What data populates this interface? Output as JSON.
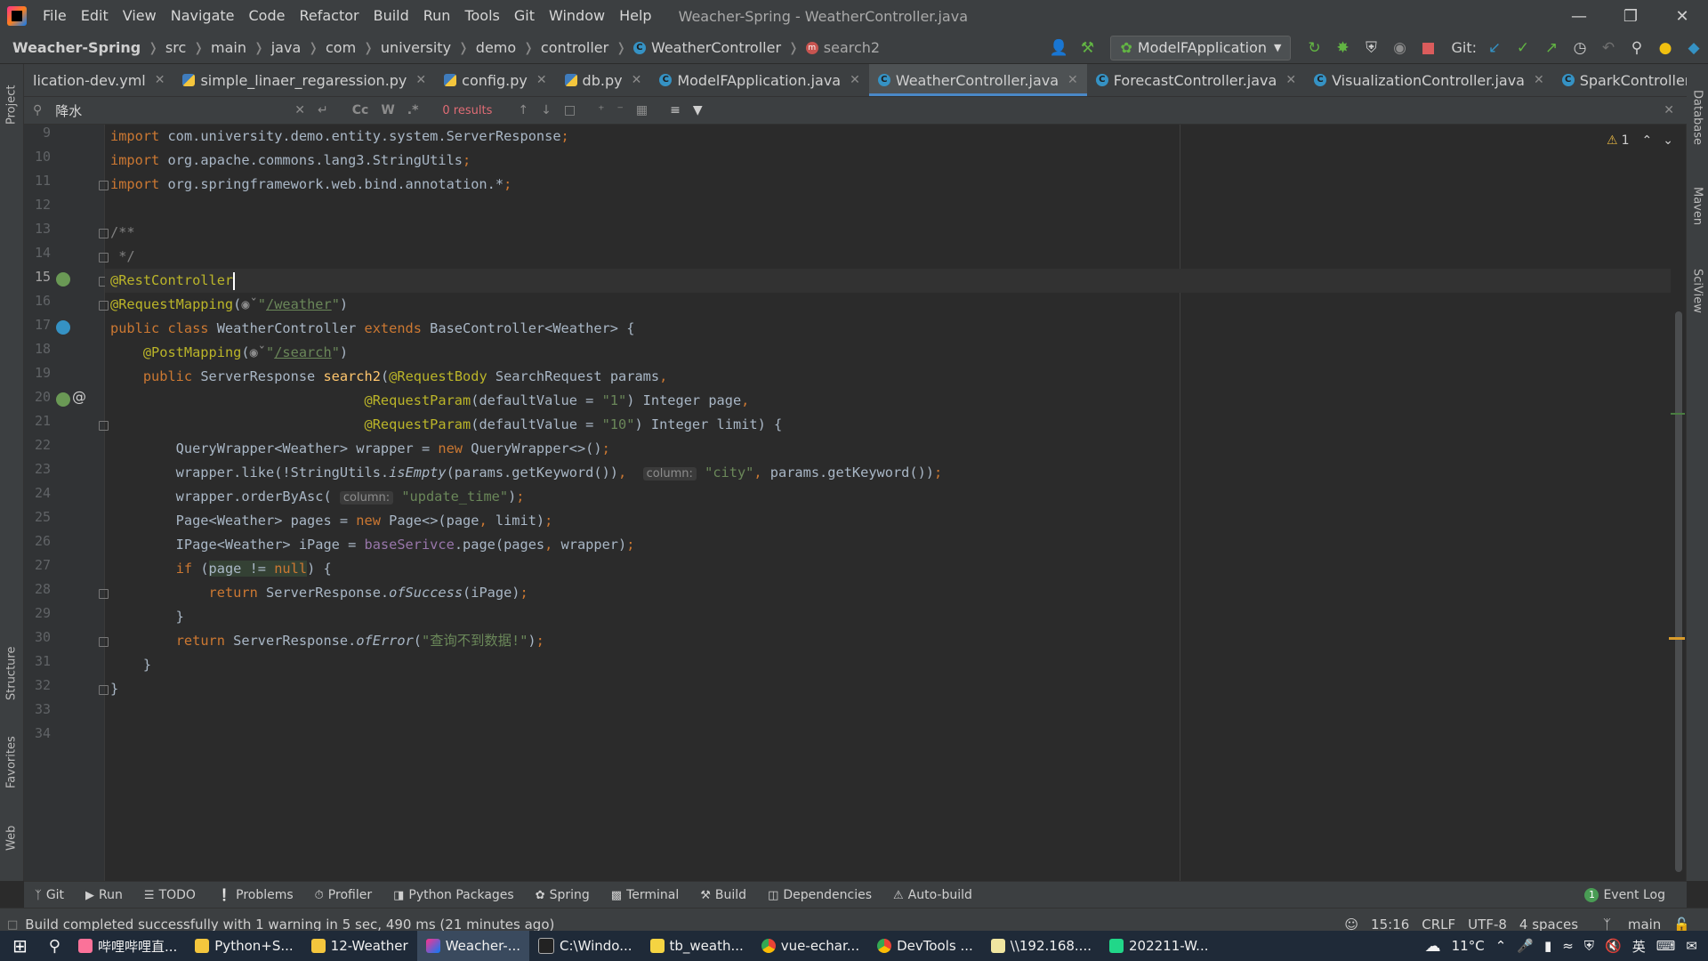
{
  "app": {
    "menu": [
      "File",
      "Edit",
      "View",
      "Navigate",
      "Code",
      "Refactor",
      "Build",
      "Run",
      "Tools",
      "Git",
      "Window",
      "Help"
    ],
    "window_title": "Weacher-Spring - WeatherController.java"
  },
  "breadcrumb": [
    "Weacher-Spring",
    "src",
    "main",
    "java",
    "com",
    "university",
    "demo",
    "controller",
    "WeatherController",
    "search2"
  ],
  "toolbar": {
    "run_config": "ModelFApplication",
    "git_label": "Git:"
  },
  "tabs": [
    {
      "label": "lication-dev.yml",
      "type": "yml",
      "active": false
    },
    {
      "label": "simple_linaer_regaression.py",
      "type": "py",
      "active": false
    },
    {
      "label": "config.py",
      "type": "py",
      "active": false
    },
    {
      "label": "db.py",
      "type": "py",
      "active": false
    },
    {
      "label": "ModelFApplication.java",
      "type": "java",
      "active": false
    },
    {
      "label": "WeatherController.java",
      "type": "java",
      "active": true
    },
    {
      "label": "ForecastController.java",
      "type": "java",
      "active": false
    },
    {
      "label": "VisualizationController.java",
      "type": "java",
      "active": false
    },
    {
      "label": "SparkController.java",
      "type": "java",
      "active": false
    }
  ],
  "search": {
    "value": "降水",
    "results": "0 results",
    "options": [
      "Cc",
      "W",
      ".*"
    ]
  },
  "editor": {
    "line_numbers": [
      "9",
      "10",
      "11",
      "12",
      "13",
      "14",
      "15",
      "16",
      "17",
      "18",
      "19",
      "20",
      "21",
      "22",
      "23",
      "24",
      "25",
      "26",
      "27",
      "28",
      "29",
      "30",
      "31",
      "32",
      "33",
      "34"
    ],
    "current_line": "15",
    "warnings": "1",
    "hints": {
      "column1": "column:",
      "column2": "column:"
    }
  },
  "side_tabs": {
    "left": [
      "Project",
      "Structure",
      "Favorites",
      "Web"
    ],
    "right": [
      "Database",
      "Maven",
      "SciView"
    ]
  },
  "tool_windows": [
    "Git",
    "Run",
    "TODO",
    "Problems",
    "Profiler",
    "Python Packages",
    "Spring",
    "Terminal",
    "Build",
    "Dependencies",
    "Auto-build"
  ],
  "event_log": "Event Log",
  "status": {
    "message": "Build completed successfully with 1 warning in 5 sec, 490 ms (21 minutes ago)",
    "position": "15:16",
    "line_sep": "CRLF",
    "encoding": "UTF-8",
    "indent": "4 spaces",
    "branch": "main"
  },
  "taskbar": {
    "apps": [
      "哔哩哔哩直...",
      "Python+S...",
      "12-Weather",
      "Weacher-...",
      "C:\\Windo...",
      "tb_weath...",
      "vue-echar...",
      "DevTools ...",
      "\\\\192.168....",
      "202211-W..."
    ],
    "active_index": 3,
    "weather": "11°C",
    "ime": "英"
  }
}
